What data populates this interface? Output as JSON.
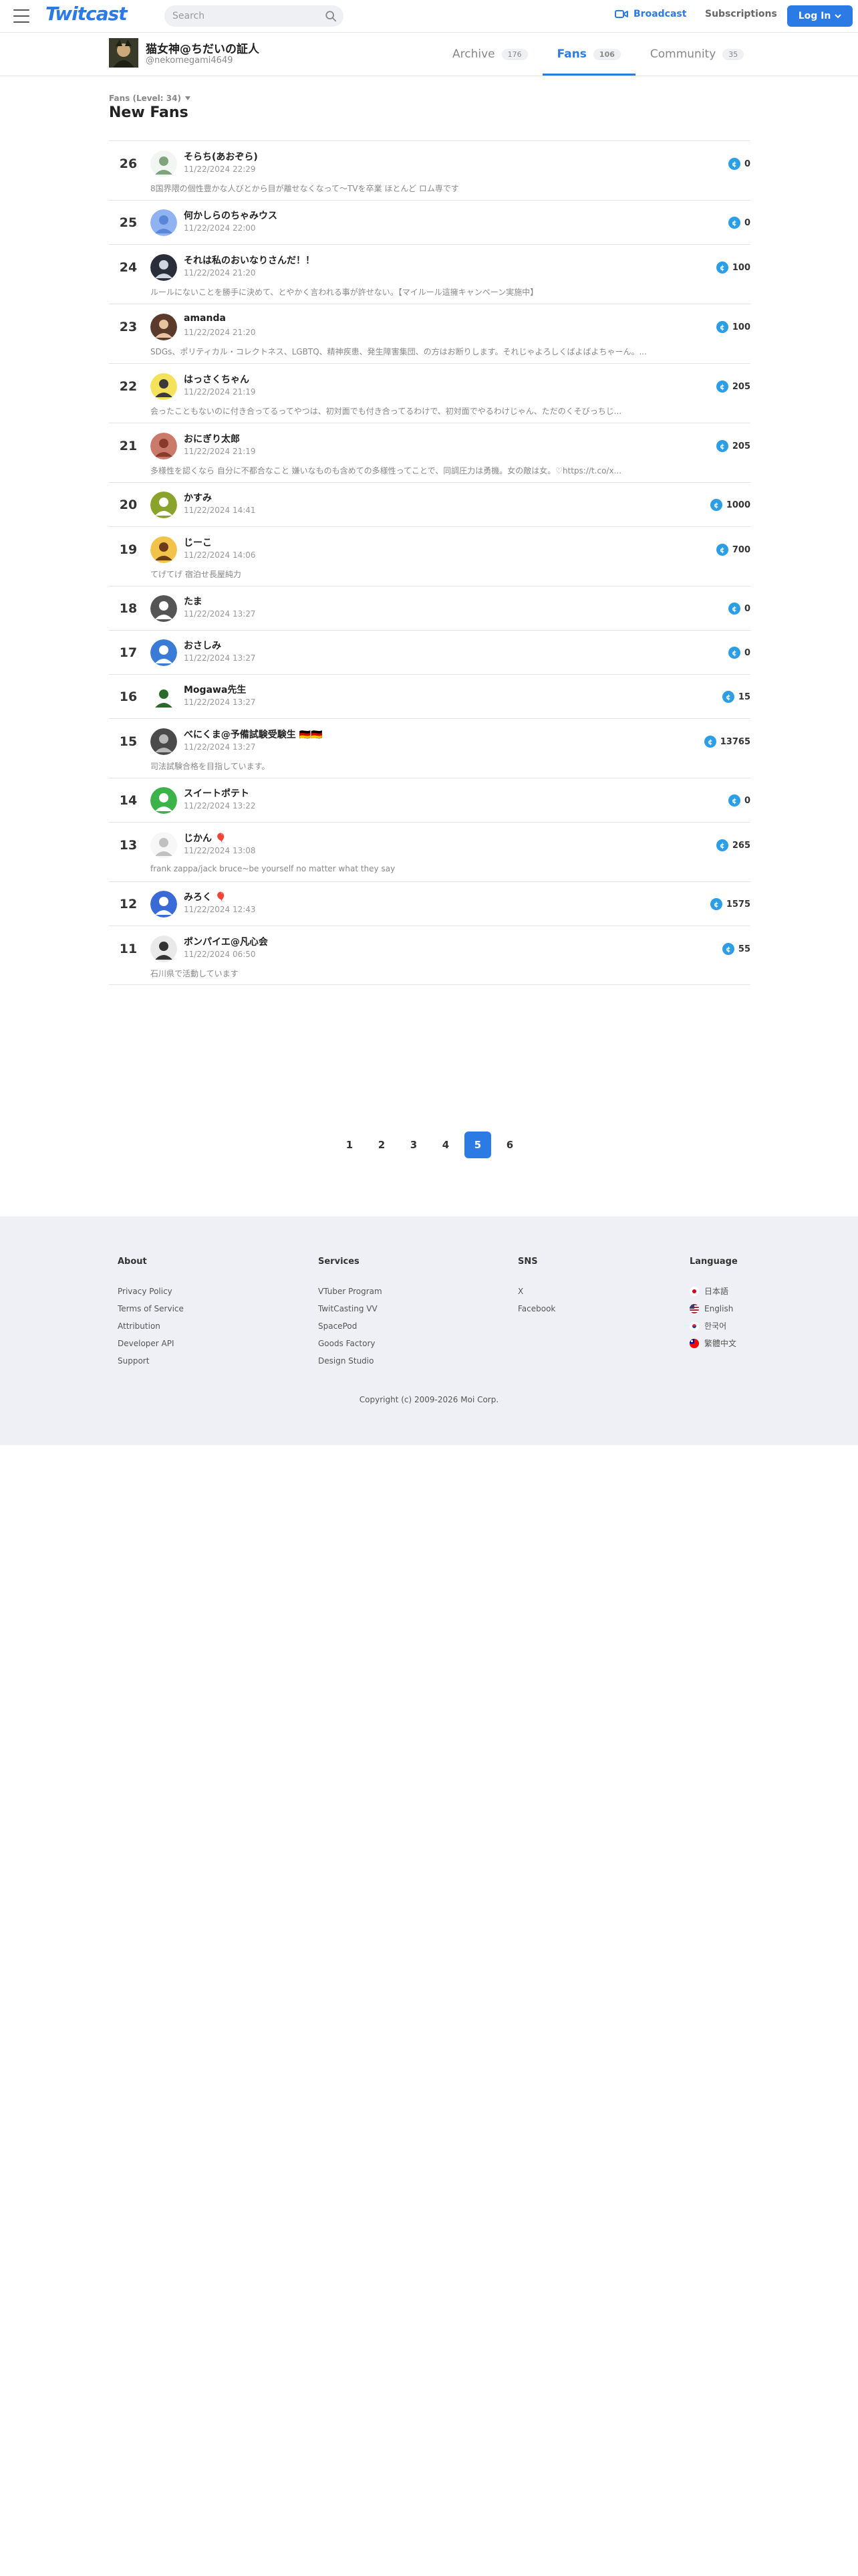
{
  "nav": {
    "logo": "Twitcast",
    "search_placeholder": "Search",
    "broadcast": "Broadcast",
    "subscriptions": "Subscriptions",
    "login": "Log In"
  },
  "profile": {
    "name": "猫女神@ちだいの証人",
    "handle": "@nekomegami4649",
    "tabs": [
      {
        "label": "Archive",
        "count": "176"
      },
      {
        "label": "Fans",
        "count": "106"
      },
      {
        "label": "Community",
        "count": "35"
      }
    ]
  },
  "section": {
    "subhead": "Fans (Level: 34)",
    "title": "New Fans"
  },
  "fans": [
    {
      "rank": "26",
      "name": "そらち(あおぞら)",
      "date": "11/22/2024 22:29",
      "bio": "8国界隈の個性豊かな人びとから目が離せなくなって〜TVを卒業 ほとんど ロム専です",
      "points": "0"
    },
    {
      "rank": "25",
      "name": "何かしらのちゃみウス",
      "date": "11/22/2024 22:00",
      "bio": "",
      "points": "0"
    },
    {
      "rank": "24",
      "name": "それは私のおいなりさんだ！！",
      "date": "11/22/2024 21:20",
      "bio": "ルールにないことを勝手に決めて、とやかく言われる事が許せない。【マイルール這擁キャンペーン実施中】",
      "points": "100"
    },
    {
      "rank": "23",
      "name": "amanda",
      "date": "11/22/2024 21:20",
      "bio": "SDGs、ポリティカル・コレクトネス、LGBTQ、精神疾患、発生障害集団、の方はお断りします。それじゃよろしくばよばよちゃーん。...",
      "points": "100"
    },
    {
      "rank": "22",
      "name": "はっさくちゃん",
      "date": "11/22/2024 21:19",
      "bio": "会ったこともないのに付き合ってるってやつは、初対面でも付き合ってるわけで、初対面でやるわけじゃん、ただのくそびっちじ...",
      "points": "205"
    },
    {
      "rank": "21",
      "name": "おにぎり太郎",
      "date": "11/22/2024 21:19",
      "bio": "多様性を認くなら 自分に不都合なこと 嫌いなものも含めての多様性ってことで、同調圧力は勇機。女の敵は女。♡https://t.co/x...",
      "points": "205"
    },
    {
      "rank": "20",
      "name": "かすみ",
      "date": "11/22/2024 14:41",
      "bio": "",
      "points": "1000"
    },
    {
      "rank": "19",
      "name": "じーこ",
      "date": "11/22/2024 14:06",
      "bio": "てげてげ 宿泊せ長屋純力",
      "points": "700"
    },
    {
      "rank": "18",
      "name": "たま",
      "date": "11/22/2024 13:27",
      "bio": "",
      "points": "0"
    },
    {
      "rank": "17",
      "name": "おさしみ",
      "date": "11/22/2024 13:27",
      "bio": "",
      "points": "0"
    },
    {
      "rank": "16",
      "name": "Mogawa先生",
      "date": "11/22/2024 13:27",
      "bio": "",
      "points": "15"
    },
    {
      "rank": "15",
      "name": "べにくま@予備試験受験生 🇩🇪🇩🇪",
      "date": "11/22/2024 13:27",
      "bio": "司法試験合格を目指しています。",
      "points": "13765"
    },
    {
      "rank": "14",
      "name": "スイートポテト",
      "date": "11/22/2024 13:22",
      "bio": "",
      "points": "0"
    },
    {
      "rank": "13",
      "name": "じかん 🎈",
      "date": "11/22/2024 13:08",
      "bio": "frank zappa/jack bruce~be yourself no matter what they say",
      "points": "265"
    },
    {
      "rank": "12",
      "name": "みろく 🎈",
      "date": "11/22/2024 12:43",
      "bio": "",
      "points": "1575"
    },
    {
      "rank": "11",
      "name": "ポンパイエ@凡心会",
      "date": "11/22/2024 06:50",
      "bio": "石川県で活動しています",
      "points": "55"
    }
  ],
  "pagination": [
    "1",
    "2",
    "3",
    "4",
    "5",
    "6"
  ],
  "pagination_active": "5",
  "footer": {
    "about": {
      "title": "About",
      "links": [
        "Privacy Policy",
        "Terms of Service",
        "Attribution",
        "Developer API",
        "Support"
      ]
    },
    "services": {
      "title": "Services",
      "links": [
        "VTuber Program",
        "TwitCasting VV",
        "SpacePod",
        "Goods Factory",
        "Design Studio"
      ]
    },
    "sns": {
      "title": "SNS",
      "links": [
        "X",
        "Facebook"
      ]
    },
    "language": {
      "title": "Language",
      "links": [
        "日本語",
        "English",
        "한국어",
        "繁體中文"
      ]
    },
    "copyright": "Copyright (c) 2009-2026 Moi Corp."
  },
  "colors": {
    "accent": "#2c7be5",
    "coin": "#2c9ee5",
    "footer_bg": "#eef0f5"
  }
}
